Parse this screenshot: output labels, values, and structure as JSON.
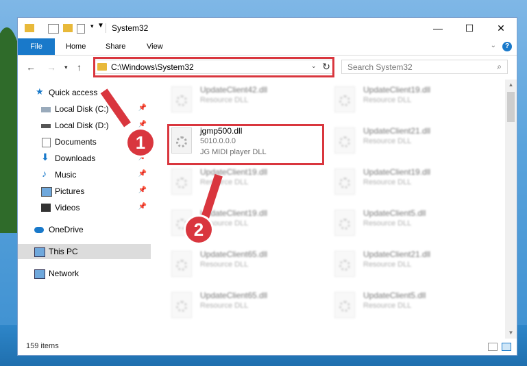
{
  "window": {
    "title": "System32"
  },
  "ribbon": {
    "tabs": [
      {
        "label": "File"
      },
      {
        "label": "Home"
      },
      {
        "label": "Share"
      },
      {
        "label": "View"
      }
    ],
    "help": "?"
  },
  "navigation": {
    "address": "C:\\Windows\\System32",
    "search_placeholder": "Search System32"
  },
  "sidebar": {
    "items": [
      {
        "label": "Quick access"
      },
      {
        "label": "Local Disk (C:)"
      },
      {
        "label": "Local Disk (D:)"
      },
      {
        "label": "Documents"
      },
      {
        "label": "Downloads"
      },
      {
        "label": "Music"
      },
      {
        "label": "Pictures"
      },
      {
        "label": "Videos"
      },
      {
        "label": "OneDrive"
      },
      {
        "label": "This PC"
      },
      {
        "label": "Network"
      }
    ]
  },
  "files": {
    "highlighted": {
      "name": "jgmp500.dll",
      "version": "5010.0.0.0",
      "description": "JG MIDI player DLL"
    },
    "left_column": [
      {
        "name": "UpdateClient42.dll",
        "type": "Resource DLL"
      },
      {
        "name": "UpdateClient19.dll",
        "type": "Resource DLL"
      },
      {
        "name": "UpdateClient19.dll",
        "type": "Resource DLL"
      },
      {
        "name": "UpdateClient65.dll",
        "type": "Resource DLL"
      },
      {
        "name": "UpdateClient65.dll",
        "type": "Resource DLL"
      }
    ],
    "right_column": [
      {
        "name": "UpdateClient19.dll",
        "type": "Resource DLL"
      },
      {
        "name": "UpdateClient21.dll",
        "type": "Resource DLL"
      },
      {
        "name": "UpdateClient19.dll",
        "type": "Resource DLL"
      },
      {
        "name": "UpdateClient5.dll",
        "type": "Resource DLL"
      },
      {
        "name": "UpdateClient21.dll",
        "type": "Resource DLL"
      },
      {
        "name": "UpdateClient5.dll",
        "type": "Resource DLL"
      }
    ]
  },
  "status": {
    "item_count": "159 items"
  },
  "annotations": {
    "step1": "1",
    "step2": "2"
  },
  "colors": {
    "accent": "#1979ca",
    "highlight": "#d9363e"
  }
}
